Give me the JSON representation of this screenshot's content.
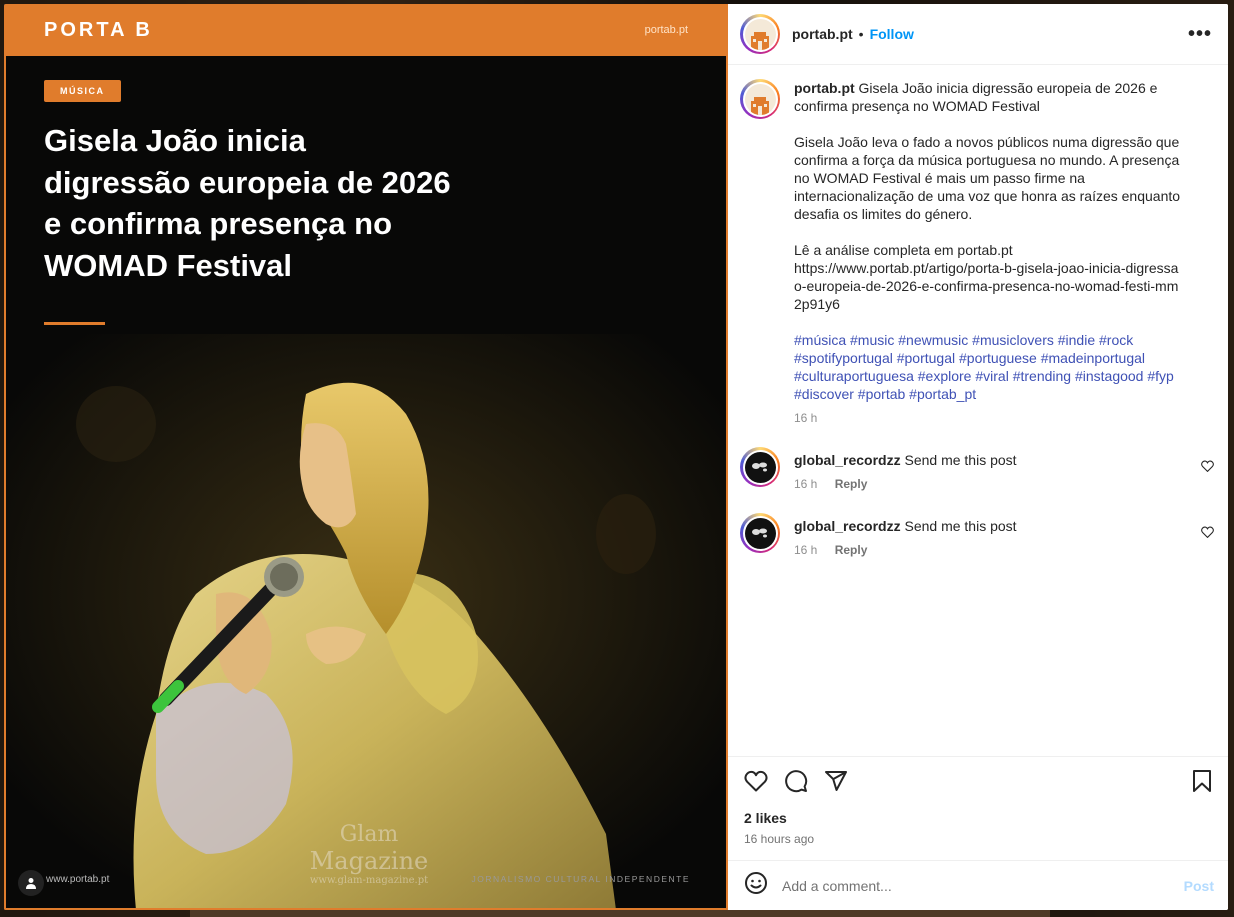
{
  "background": {
    "label_left": "PORTA B",
    "label_right": "PORTA B"
  },
  "post_image": {
    "brand": "PORTA B",
    "site_top": "portab.pt",
    "category": "MÚSICA",
    "headline": "Gisela João inicia digressão europeia de 2026 e confirma presença no WOMAD Festival",
    "watermark_line1": "Glam",
    "watermark_line2": "Magazine",
    "watermark_line3": "www.glam-magazine.pt",
    "footer_site": "www.portab.pt",
    "footer_tag": "JORNALISMO CULTURAL INDEPENDENTE",
    "accent_color": "#e07c2c"
  },
  "header": {
    "username": "portab.pt",
    "separator": "•",
    "follow_label": "Follow",
    "more_label": "•••"
  },
  "caption": {
    "username": "portab.pt",
    "title": "Gisela João inicia digressão europeia de 2026 e confirma presença no WOMAD Festival",
    "paragraph1": "Gisela João leva o fado a novos públicos numa digressão que confirma a força da música portuguesa no mundo. A presença no WOMAD Festival é mais um passo firme na internacionalização de uma voz que honra as raízes enquanto desafia os limites do género.",
    "paragraph2_line1": "Lê a análise completa em portab.pt",
    "paragraph2_url": "https://www.portab.pt/artigo/porta-b-gisela-joao-inicia-digressao-europeia-de-2026-e-confirma-presenca-no-womad-festi-mm2p91y6",
    "hashtags": "#música #music #newmusic #musiclovers #indie #rock #spotifyportugal #portugal #portuguese #madeinportugal #culturaportuguesa #explore #viral #trending #instagood #fyp #discover #portab #portab_pt",
    "time": "16 h"
  },
  "comments": [
    {
      "username": "global_recordzz",
      "text": "Send me this post",
      "time": "16 h",
      "reply_label": "Reply"
    },
    {
      "username": "global_recordzz",
      "text": "Send me this post",
      "time": "16 h",
      "reply_label": "Reply"
    }
  ],
  "actions": {
    "likes": "2 likes",
    "time_ago": "16 hours ago",
    "icons": [
      "heart-icon",
      "comment-icon",
      "share-icon",
      "bookmark-icon"
    ]
  },
  "add_comment": {
    "placeholder": "Add a comment...",
    "post_label": "Post",
    "post_color": "#b3dbff"
  }
}
